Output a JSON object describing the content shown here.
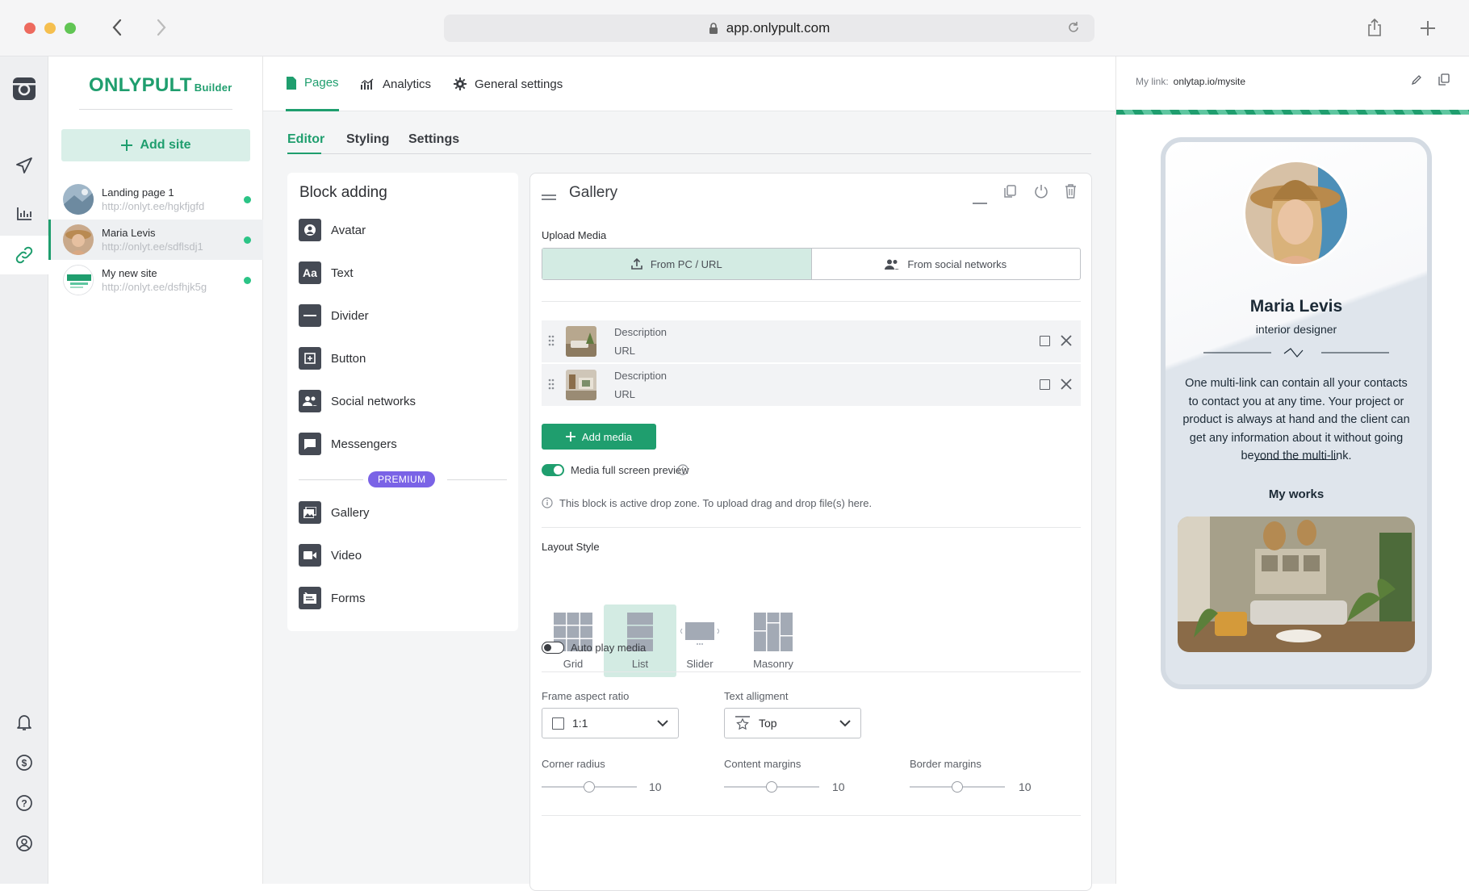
{
  "browser": {
    "url": "app.onlypult.com"
  },
  "brand": {
    "name": "ONLYPULT",
    "suffix": "Builder",
    "accent": "#1f9e6e"
  },
  "sites_panel": {
    "add_site_label": "Add site",
    "sites": [
      {
        "name": "Landing page 1",
        "url": "http://onlyt.ee/hgkfjgfd",
        "active": false
      },
      {
        "name": "Maria Levis",
        "url": "http://onlyt.ee/sdflsdj1",
        "active": true
      },
      {
        "name": "My new site",
        "url": "http://onlyt.ee/dsfhjk5g",
        "active": false
      }
    ]
  },
  "top_nav": {
    "tabs": [
      {
        "label": "Pages",
        "icon": "file-icon",
        "active": true
      },
      {
        "label": "Analytics",
        "icon": "chart-icon",
        "active": false
      },
      {
        "label": "General settings",
        "icon": "gear-icon",
        "active": false
      }
    ]
  },
  "sub_tabs": [
    {
      "label": "Editor",
      "active": true
    },
    {
      "label": "Styling",
      "active": false
    },
    {
      "label": "Settings",
      "active": false
    }
  ],
  "block_adding": {
    "title": "Block adding",
    "items": [
      "Avatar",
      "Text",
      "Divider",
      "Button",
      "Social networks",
      "Messengers"
    ],
    "premium_label": "PREMIUM",
    "premium_items": [
      "Gallery",
      "Video",
      "Forms"
    ]
  },
  "gallery": {
    "title": "Gallery",
    "upload_media_label": "Upload Media",
    "upload_tabs": [
      "From PC / URL",
      "From social networks"
    ],
    "media_items": [
      {
        "description": "Description",
        "url": "URL"
      },
      {
        "description": "Description",
        "url": "URL"
      }
    ],
    "add_media_label": "Add media",
    "full_screen_label": "Media full screen preview",
    "full_screen_on": true,
    "drop_zone_note": "This block is active drop zone. To upload drag and drop file(s) here.",
    "layout_style_label": "Layout Style",
    "layouts": [
      {
        "label": "Grid",
        "active": false
      },
      {
        "label": "List",
        "active": true
      },
      {
        "label": "Slider",
        "active": false
      },
      {
        "label": "Masonry",
        "active": false
      }
    ],
    "autoplay_label": "Auto play media",
    "autoplay_on": false,
    "frame_ratio_label": "Frame aspect ratio",
    "frame_ratio_value": "1:1",
    "text_alignment_label": "Text alligment",
    "text_alignment_value": "Top",
    "corner_radius_label": "Corner radius",
    "corner_radius_value": "10",
    "content_margins_label": "Content margins",
    "content_margins_value": "10",
    "border_margins_label": "Border margins",
    "border_margins_value": "10"
  },
  "preview": {
    "my_link_label": "My link:",
    "my_link_value": "onlytap.io/mysite",
    "profile_name": "Maria Levis",
    "profile_role": "interior designer",
    "profile_description": "One multi-link can contain all your contacts to contact you at any time. Your project or product is always at hand and the client can get any information about it without going beyond the multi-link.",
    "section_title": "My works"
  }
}
